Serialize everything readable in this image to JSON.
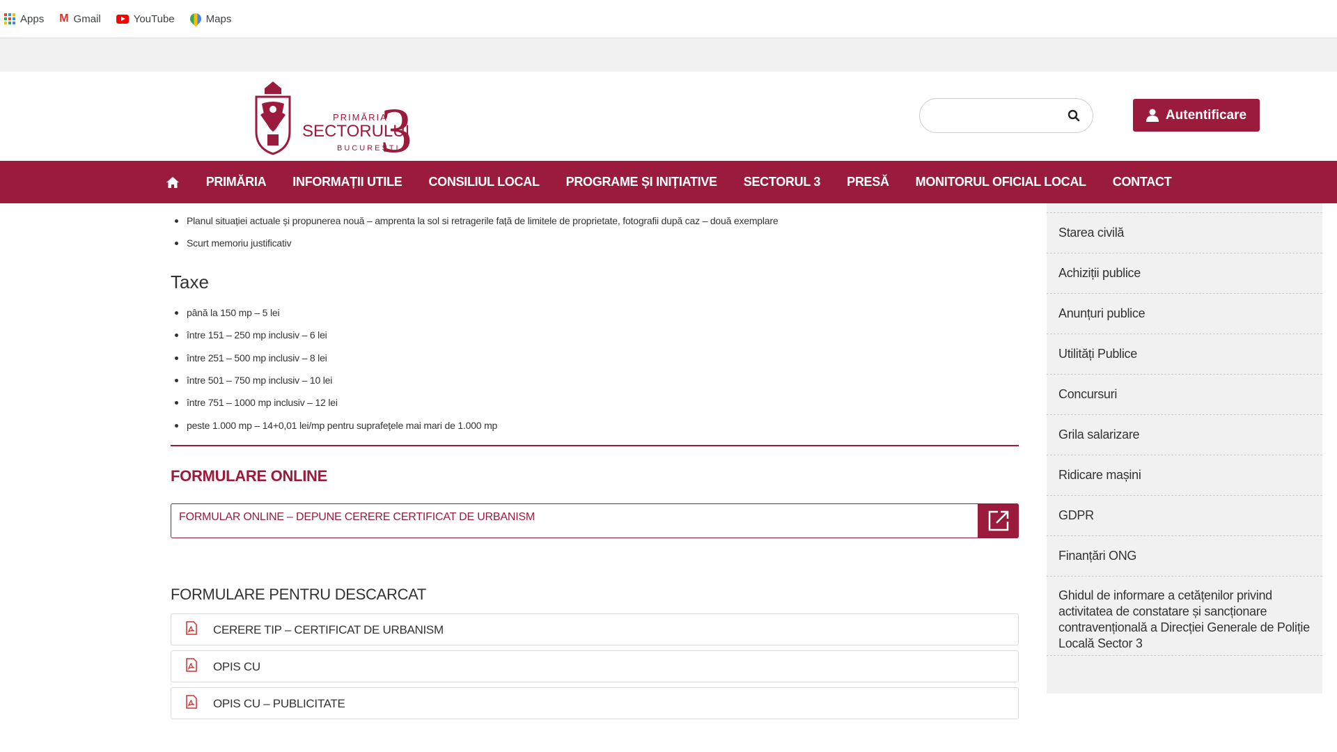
{
  "bookmarks": [
    {
      "label": "Apps",
      "icon": "apps-grid-icon"
    },
    {
      "label": "Gmail",
      "icon": "gmail-icon"
    },
    {
      "label": "YouTube",
      "icon": "youtube-icon"
    },
    {
      "label": "Maps",
      "icon": "maps-icon"
    }
  ],
  "logo": {
    "line1": "PRIMĂRIA",
    "line2": "SECTORULUI",
    "line3": "BUCUREȘTI",
    "number": "3"
  },
  "search": {
    "value": "",
    "placeholder": ""
  },
  "login": {
    "label": "Autentificare"
  },
  "nav": {
    "home_icon": "home-icon",
    "items": [
      "PRIMĂRIA",
      "INFORMAȚII UTILE",
      "CONSILIUL LOCAL",
      "PROGRAME ȘI INIȚIATIVE",
      "SECTORUL 3",
      "PRESĂ",
      "MONITORUL OFICIAL LOCAL",
      "CONTACT"
    ]
  },
  "content": {
    "top_bullets": [
      "Planul situației actuale și propunerea nouă – amprenta la sol si retragerile față de limitele de proprietate, fotografii după caz – două exemplare",
      "Scurt memoriu justificativ"
    ],
    "taxe_title": "Taxe",
    "taxe": [
      "până la 150 mp – 5 lei",
      "între 151 – 250 mp inclusiv – 6 lei",
      "între 251 – 500 mp inclusiv – 8 lei",
      "între 501 – 750 mp inclusiv – 10 lei",
      "între 751 – 1000 mp inclusiv – 12 lei",
      "peste 1.000 mp – 14+0,01 lei/mp pentru suprafețele mai mari de 1.000 mp"
    ],
    "online_title": "FORMULARE ONLINE",
    "online_form": "FORMULAR ONLINE – DEPUNE CERERE CERTIFICAT DE URBANISM",
    "download_title": "FORMULARE PENTRU DESCARCAT",
    "downloads": [
      "CERERE TIP – CERTIFICAT DE URBANISM",
      "OPIS CU",
      "OPIS CU – PUBLICITATE"
    ]
  },
  "sidebar": {
    "items": [
      "Starea civilă",
      "Achiziții publice",
      "Anunțuri publice",
      "Utilități Publice",
      "Concursuri",
      "Grila salarizare",
      "Ridicare mașini",
      "GDPR",
      "Finanțări ONG",
      "Ghidul de informare a cetățenilor privind activitatea de constatare și sancționare contravențională a Direcției Generale de Poliție Locală Sector 3"
    ]
  },
  "colors": {
    "brand": "#9b1b3d",
    "sidebar_bg": "#f1f1f1",
    "pdf_red": "#d32f2f"
  }
}
